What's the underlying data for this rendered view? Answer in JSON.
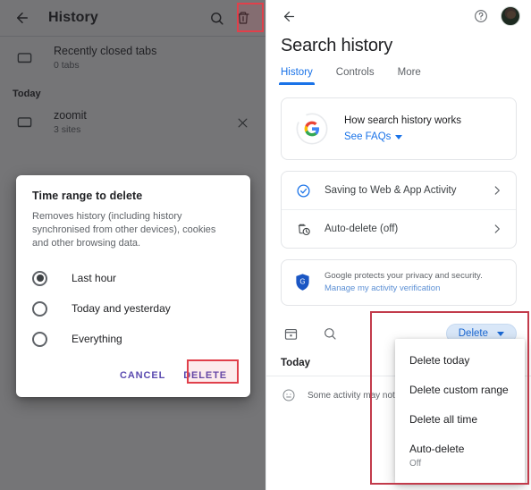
{
  "left_panel": {
    "appbar": {
      "back_icon": "arrow-left-icon",
      "title": "History",
      "search_icon": "search-icon",
      "delete_icon": "trash-icon"
    },
    "rows": [
      {
        "icon": "tabs-icon",
        "title": "Recently closed tabs",
        "subtitle": "0 tabs"
      }
    ],
    "section_label": "Today",
    "history_entries": [
      {
        "icon": "tabs-icon",
        "title": "zoomit",
        "subtitle": "3 sites",
        "close_icon": "close-icon"
      }
    ],
    "dialog": {
      "title": "Time range to delete",
      "body": "Removes history (including history synchronised from other devices), cookies and other browsing data.",
      "options": [
        {
          "label": "Last hour",
          "selected": true
        },
        {
          "label": "Today and yesterday",
          "selected": false
        },
        {
          "label": "Everything",
          "selected": false
        }
      ],
      "cancel_label": "CANCEL",
      "delete_label": "DELETE"
    },
    "highlight_color": "#e0404b"
  },
  "right_panel": {
    "topbar": {
      "back_icon": "arrow-left-icon",
      "help_icon": "help-circle-icon",
      "avatar": "account-avatar"
    },
    "page_title": "Search history",
    "tabs": [
      {
        "label": "History",
        "active": true
      },
      {
        "label": "Controls",
        "active": false
      },
      {
        "label": "More",
        "active": false
      }
    ],
    "faq_card": {
      "icon": "google-g-logo",
      "title": "How search history works",
      "link_label": "See FAQs",
      "caret_icon": "chevron-down-icon"
    },
    "settings_list": [
      {
        "icon": "check-circle-icon",
        "label": "Saving to Web & App Activity",
        "chevron": "chevron-right-icon"
      },
      {
        "icon": "auto-delete-icon",
        "label": "Auto-delete (off)",
        "chevron": "chevron-right-icon"
      }
    ],
    "privacy_card": {
      "icon": "shield-g-icon",
      "line1": "Google protects your privacy and security.",
      "line2": "Manage my activity verification"
    },
    "toolbar": {
      "calendar_icon": "calendar-icon",
      "search_icon": "search-icon",
      "delete_chip_label": "Delete",
      "delete_chip_caret": "chevron-down-icon",
      "chip_bg": "#d9e7f8",
      "chip_fg": "#1967d2"
    },
    "day_header": "Today",
    "note": {
      "icon": "info-face-icon",
      "text": "Some activity may not a"
    },
    "dropdown_menu": [
      {
        "label": "Delete today",
        "sub": ""
      },
      {
        "label": "Delete custom range",
        "sub": ""
      },
      {
        "label": "Delete all time",
        "sub": ""
      },
      {
        "label": "Auto-delete",
        "sub": "Off"
      }
    ],
    "highlight_color": "#c23b4b"
  }
}
